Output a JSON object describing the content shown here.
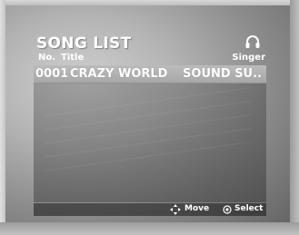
{
  "screen": {
    "title": "SONG LIST",
    "columns": {
      "no": "No.",
      "title": "Title",
      "singer": "Singer"
    },
    "singer_icon": "headphone-icon"
  },
  "songs": [
    {
      "no": "0001",
      "title": "CRAZY WORLD",
      "singer": "SOUND SU..",
      "selected": true
    }
  ],
  "footer": {
    "move_icon": "four-way-arrow-icon",
    "move_label": "Move",
    "select_icon": "enter-circle-icon",
    "select_label": "Select"
  },
  "colors": {
    "highlight": "#b4b4b4",
    "text": "#ffffff"
  }
}
